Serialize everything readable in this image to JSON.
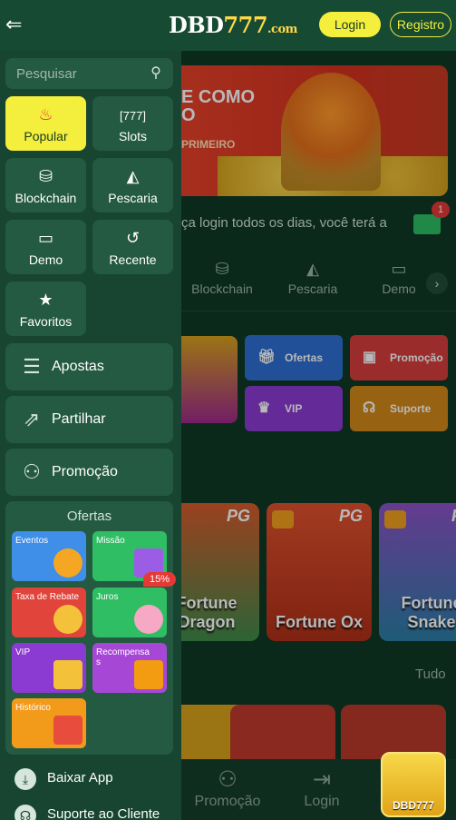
{
  "header": {
    "logo_text": "DBD",
    "logo_num": "777",
    "logo_domain": ".com",
    "login_label": "Login",
    "register_label": "Registro"
  },
  "sidebar": {
    "search_placeholder": "Pesquisar",
    "categories": [
      {
        "label": "Popular",
        "icon": "flame-icon",
        "active": true
      },
      {
        "label": "Slots",
        "icon": "slot-777-icon"
      },
      {
        "label": "Blockchain",
        "icon": "blockchain-icon"
      },
      {
        "label": "Pescaria",
        "icon": "shark-icon"
      },
      {
        "label": "Demo",
        "icon": "gamepad-icon"
      },
      {
        "label": "Recente",
        "icon": "history-icon"
      },
      {
        "label": "Favoritos",
        "icon": "star-icon"
      }
    ],
    "menu": [
      {
        "label": "Apostas",
        "icon": "coin-stack-icon"
      },
      {
        "label": "Partilhar",
        "icon": "share-icon"
      },
      {
        "label": "Promoção",
        "icon": "users-icon"
      }
    ],
    "offers": {
      "title": "Ofertas",
      "items": [
        {
          "label": "Eventos",
          "color": "#3f8ee8"
        },
        {
          "label": "Missão",
          "color": "#2fbe63"
        },
        {
          "label": "Taxa de Rebate",
          "color": "#e0443b"
        },
        {
          "label": "Juros",
          "color": "#2fbe63",
          "badge": "15%"
        },
        {
          "label": "VIP",
          "color": "#8b3bd2"
        },
        {
          "label": "Recompensas",
          "color": "#a747d6"
        },
        {
          "label": "Histórico",
          "color": "#f29a1a"
        }
      ]
    },
    "footer": [
      {
        "label": "Baixar App",
        "icon": "download-icon"
      },
      {
        "label": "Suporte ao Cliente",
        "icon": "headset-icon"
      }
    ]
  },
  "background": {
    "banner_line1": "E COMO",
    "banner_line2": "O",
    "banner_line3": "PRIMEIRO",
    "marquee": "ça login todos os dias, você terá a",
    "mail_badge": "1",
    "categories": [
      "Blockchain",
      "Pescaria",
      "Demo"
    ],
    "tiles": [
      {
        "label": "Ofertas",
        "color": "#2e6fd3"
      },
      {
        "label": "Promoção",
        "color": "#d73d3d"
      },
      {
        "label": "VIP",
        "color": "#8b3bd2"
      },
      {
        "label": "Suporte",
        "color": "#d18a1a"
      }
    ],
    "games": [
      {
        "provider": "PG",
        "name": "Fortune Dragon"
      },
      {
        "provider": "PG",
        "name": "Fortune Ox"
      },
      {
        "provider": "PG",
        "name": "Fortune Snake"
      }
    ],
    "see_all": "Tudo",
    "bottom_nav": [
      "Promoção",
      "Login"
    ],
    "app_badge": "DBD777"
  },
  "colors": {
    "accent": "#f4ee3c",
    "sidebar_bg": "#174531",
    "card_bg": "#245a41"
  }
}
